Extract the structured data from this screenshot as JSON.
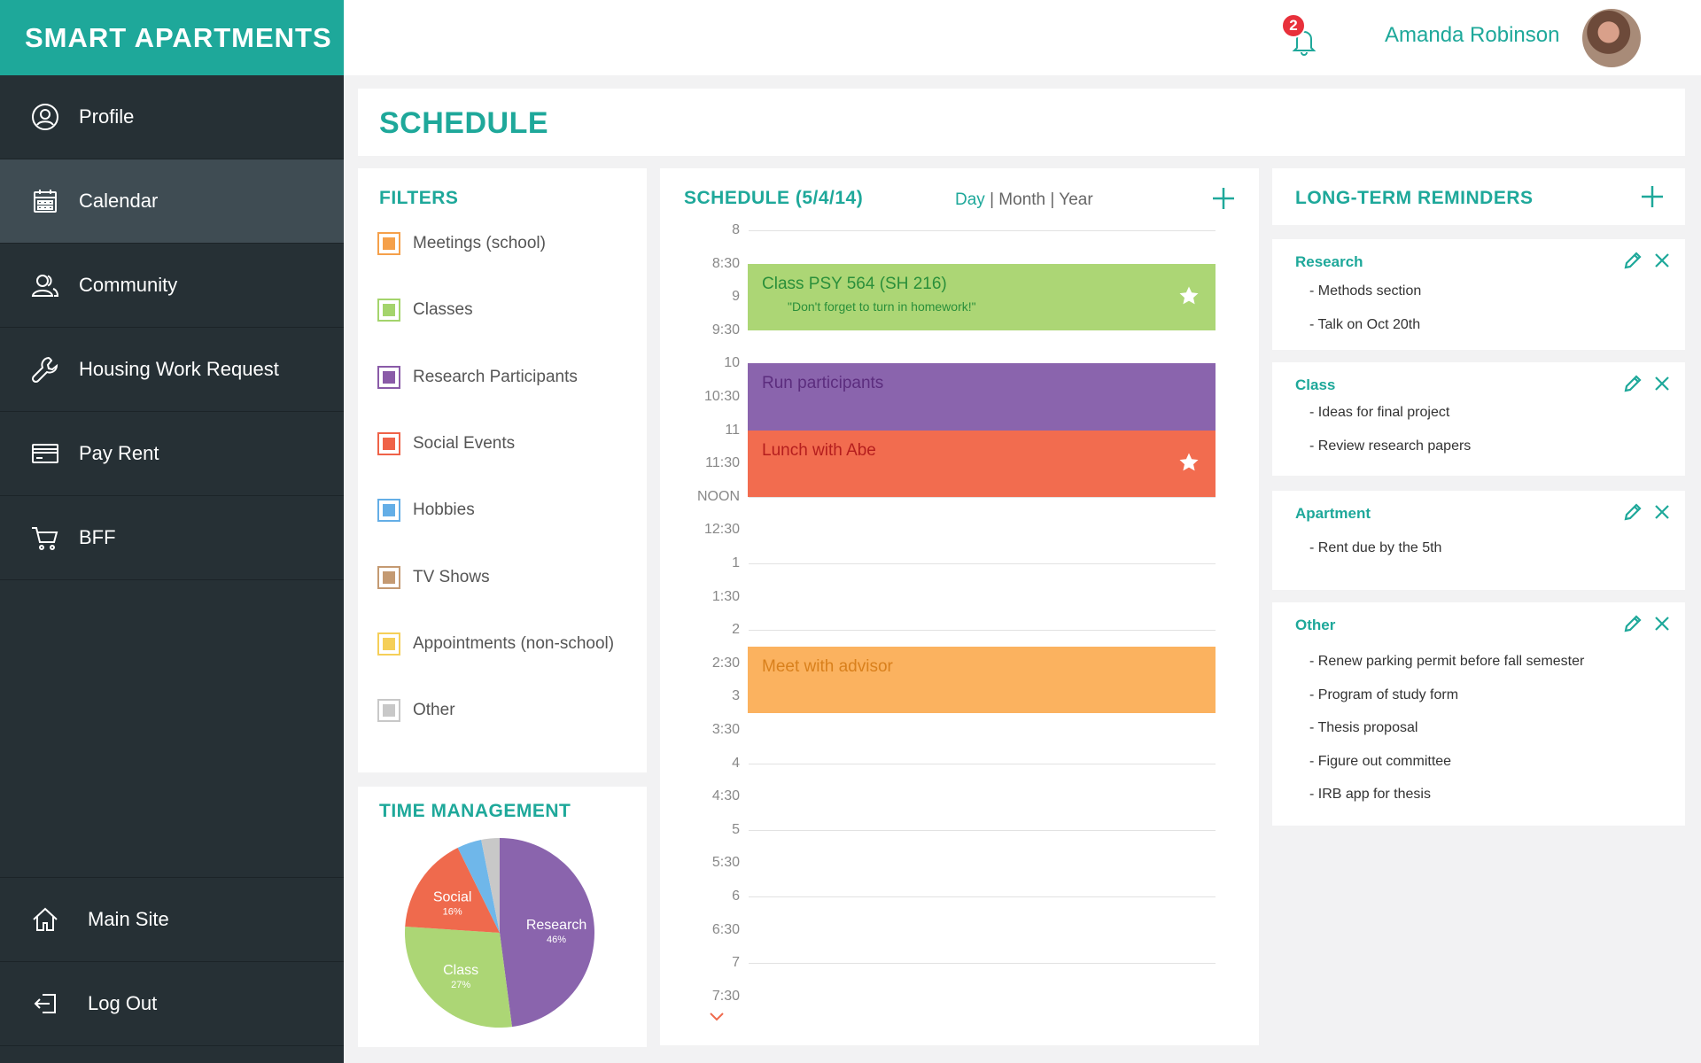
{
  "brand": "SMART APARTMENTS",
  "colors": {
    "accent": "#1ea89a",
    "sidebar": "#263035",
    "sidebar_active": "#3f4c53",
    "badge": "#e8303b"
  },
  "sidebar": {
    "items": [
      {
        "label": "Profile",
        "icon": "user-circle-icon",
        "active": false
      },
      {
        "label": "Calendar",
        "icon": "calendar-icon",
        "active": true
      },
      {
        "label": "Community",
        "icon": "people-icon",
        "active": false
      },
      {
        "label": "Housing Work Request",
        "icon": "wrench-icon",
        "active": false
      },
      {
        "label": "Pay Rent",
        "icon": "credit-card-icon",
        "active": false
      },
      {
        "label": "BFF",
        "icon": "cart-icon",
        "active": false
      }
    ],
    "bottom_items": [
      {
        "label": "Main Site",
        "icon": "home-icon"
      },
      {
        "label": "Log Out",
        "icon": "logout-icon"
      }
    ]
  },
  "header": {
    "notification_count": "2",
    "user_name": "Amanda Robinson"
  },
  "page_title": "SCHEDULE",
  "filters": {
    "title": "FILTERS",
    "items": [
      {
        "label": "Meetings (school)",
        "color": "#f5a04a"
      },
      {
        "label": "Classes",
        "color": "#a4d46c"
      },
      {
        "label": "Research Participants",
        "color": "#8a5ba8"
      },
      {
        "label": "Social Events",
        "color": "#ef6248"
      },
      {
        "label": "Hobbies",
        "color": "#64aee6"
      },
      {
        "label": "TV Shows",
        "color": "#c49a72"
      },
      {
        "label": "Appointments (non-school)",
        "color": "#f5cf58"
      },
      {
        "label": "Other",
        "color": "#c8c8c8"
      }
    ]
  },
  "time_management": {
    "title": "TIME MANAGEMENT",
    "slices": [
      {
        "label": "Research",
        "pct_label": "46%",
        "value": 46,
        "color": "#8a64ad"
      },
      {
        "label": "Class",
        "pct_label": "27%",
        "value": 27,
        "color": "#acd675"
      },
      {
        "label": "Social",
        "pct_label": "16%",
        "value": 16,
        "color": "#ef6a4d"
      },
      {
        "label": "",
        "pct_label": "",
        "value": 4,
        "color": "#6fb7ea"
      },
      {
        "label": "",
        "pct_label": "",
        "value": 3,
        "color": "#c8c8c8"
      }
    ]
  },
  "schedule": {
    "title": "SCHEDULE (5/4/14)",
    "views": {
      "day": "Day",
      "month": "Month",
      "year": "Year",
      "sep": "|"
    },
    "time_labels": [
      "8",
      "8:30",
      "9",
      "9:30",
      "10",
      "10:30",
      "11",
      "11:30",
      "NOON",
      "12:30",
      "1",
      "1:30",
      "2",
      "2:30",
      "3",
      "3:30",
      "4",
      "4:30",
      "5",
      "5:30",
      "6",
      "6:30",
      "7",
      "7:30"
    ],
    "events": [
      {
        "title": "Class PSY 564 (SH 216)",
        "note": "\"Don't forget to turn in homework!\"",
        "start": 1,
        "end": 3,
        "color": "#acd675",
        "text_color": "#2a8f3a",
        "starred": true
      },
      {
        "title": "Run participants",
        "note": "",
        "start": 4,
        "end": 6,
        "color": "#8a64ad",
        "text_color": "#5c2d7e",
        "starred": false
      },
      {
        "title": "Lunch with Abe",
        "note": "",
        "start": 6,
        "end": 8,
        "color": "#f26c4f",
        "text_color": "#b51e1e",
        "starred": true
      },
      {
        "title": "Meet with advisor",
        "note": "",
        "start": 12.5,
        "end": 14.5,
        "color": "#fbb25f",
        "text_color": "#d9801c",
        "starred": false
      }
    ]
  },
  "reminders": {
    "title": "LONG-TERM REMINDERS",
    "cards": [
      {
        "title": "Research",
        "items": [
          "- Methods section",
          "- Talk on Oct 20th"
        ]
      },
      {
        "title": "Class",
        "items": [
          "- Ideas for final project",
          "- Review research papers"
        ]
      },
      {
        "title": "Apartment",
        "items": [
          "- Rent due by the 5th"
        ]
      },
      {
        "title": "Other",
        "items": [
          "- Renew parking permit before fall semester",
          "- Program of study form",
          "- Thesis proposal",
          "- Figure out committee",
          "- IRB app for thesis"
        ]
      }
    ]
  }
}
